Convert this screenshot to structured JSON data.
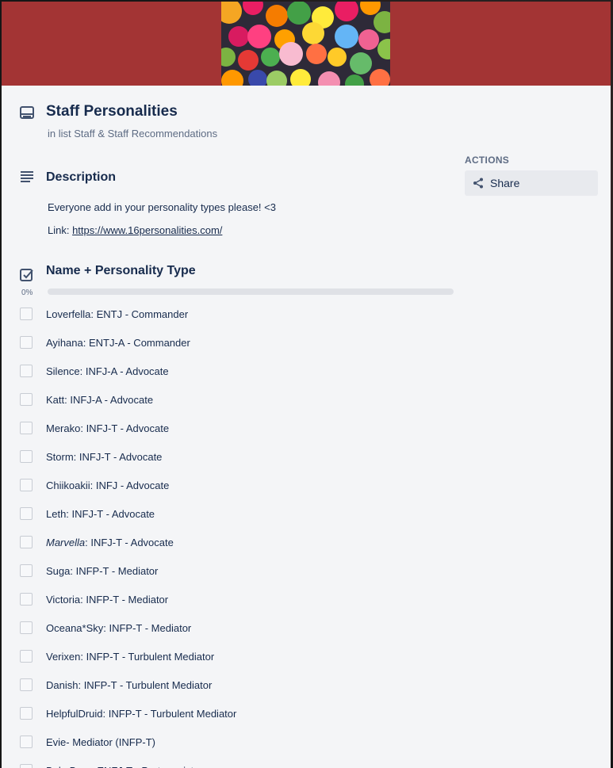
{
  "card": {
    "title": "Staff Personalities",
    "in_list": "in list Staff & Staff Recommendations"
  },
  "description": {
    "title": "Description",
    "line1": "Everyone add in your personality types please! <3",
    "link_prefix": "Link: ",
    "link_text": "https://www.16personalities.com/"
  },
  "checklist": {
    "title": "Name + Personality Type",
    "progress_label": "0%",
    "progress": 0,
    "items": [
      {
        "italic": "",
        "text": "Loverfella: ENTJ - Commander"
      },
      {
        "italic": "",
        "text": "Ayihana: ENTJ-A - Commander"
      },
      {
        "italic": "",
        "text": "Silence: INFJ-A - Advocate"
      },
      {
        "italic": "",
        "text": "Katt: INFJ-A - Advocate"
      },
      {
        "italic": "",
        "text": "Merako: INFJ-T - Advocate"
      },
      {
        "italic": "",
        "text": "Storm: INFJ-T - Advocate"
      },
      {
        "italic": "",
        "text": "Chiikoakii: INFJ - Advocate"
      },
      {
        "italic": "",
        "text": "Leth: INFJ-T - Advocate"
      },
      {
        "italic": "Marvella",
        "text": ": INFJ-T - Advocate"
      },
      {
        "italic": "",
        "text": "Suga: INFP-T - Mediator"
      },
      {
        "italic": "",
        "text": "Victoria: INFP-T - Mediator"
      },
      {
        "italic": "",
        "text": "Oceana*Sky: INFP-T - Mediator"
      },
      {
        "italic": "",
        "text": "Verixen: INFP-T - Turbulent Mediator"
      },
      {
        "italic": "",
        "text": "Danish: INFP-T - Turbulent Mediator"
      },
      {
        "italic": "",
        "text": "HelpfulDruid: INFP-T - Turbulent Mediator"
      },
      {
        "italic": "",
        "text": "Evie- Mediator (INFP-T)"
      },
      {
        "italic": "",
        "text": "BubsBear: ENFJ-T - Protagonist"
      }
    ]
  },
  "sidebar": {
    "actions_label": "ACTIONS",
    "share_label": "Share"
  },
  "colors": {
    "cover": "#a33434",
    "panel": "#f4f5f7",
    "text": "#172b4d",
    "muted": "#5e6c84"
  },
  "icons": [
    "card-icon",
    "description-icon",
    "checklist-icon",
    "share-icon"
  ]
}
